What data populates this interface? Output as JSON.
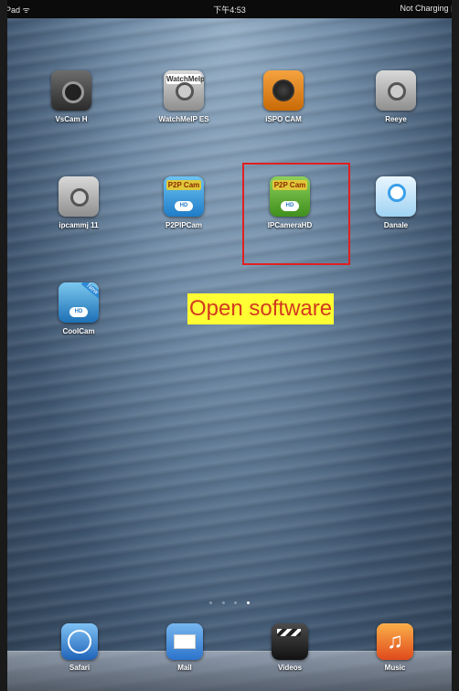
{
  "status_bar": {
    "left": "iPad ᯤ",
    "time": "下午4:53",
    "right": "Not Charging ▮"
  },
  "apps": [
    {
      "label": "VsCam H",
      "style": "cam-dark"
    },
    {
      "label": "WatchMeIP ES",
      "style": "gray",
      "tag": "WatchMeIp"
    },
    {
      "label": "iSPO CAM",
      "style": "orange"
    },
    {
      "label": "Reeye",
      "style": "gray"
    },
    {
      "label": "ipcammj 11",
      "style": "gray"
    },
    {
      "label": "P2PIPCam",
      "style": "p2p-blue",
      "tag": "P2P Cam",
      "cloud": "HD"
    },
    {
      "label": "IPCameraHD",
      "style": "p2p-green",
      "tag": "P2P Cam",
      "cloud": "HD"
    },
    {
      "label": "Danale",
      "style": "dansle"
    },
    {
      "label": "CoolCam",
      "style": "p2p-cool",
      "tag": "New",
      "cloud": "HD"
    }
  ],
  "annotation": "Open software",
  "page_indicator": {
    "count": 4,
    "active_index": 3
  },
  "dock": [
    {
      "label": "Safari",
      "style": "safari"
    },
    {
      "label": "Mail",
      "style": "mail"
    },
    {
      "label": "Videos",
      "style": "videos"
    },
    {
      "label": "Music",
      "style": "music",
      "glyph": "♫"
    }
  ]
}
